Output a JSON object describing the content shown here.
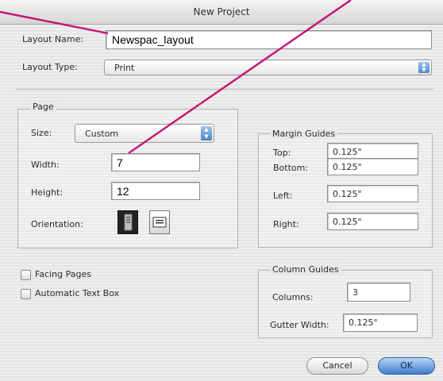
{
  "window": {
    "title": "New Project"
  },
  "layout": {
    "name_label": "Layout Name:",
    "name_value": "Newspac_layout",
    "type_label": "Layout Type:",
    "type_value": "Print"
  },
  "page": {
    "group_label": "Page",
    "size_label": "Size:",
    "size_value": "Custom",
    "width_label": "Width:",
    "width_value": "7",
    "height_label": "Height:",
    "height_value": "12",
    "orientation_label": "Orientation:",
    "orientation_selected": "portrait"
  },
  "margins": {
    "group_label": "Margin Guides",
    "top_label": "Top:",
    "top_value": "0.125\"",
    "bottom_label": "Bottom:",
    "bottom_value": "0.125\"",
    "left_label": "Left:",
    "left_value": "0.125\"",
    "right_label": "Right:",
    "right_value": "0.125\""
  },
  "options": {
    "facing_pages_label": "Facing Pages",
    "facing_pages_checked": false,
    "auto_text_box_label": "Automatic Text Box",
    "auto_text_box_checked": false
  },
  "columns": {
    "group_label": "Column Guides",
    "columns_label": "Columns:",
    "columns_value": "3",
    "gutter_label": "Gutter Width:",
    "gutter_value": "0.125\""
  },
  "buttons": {
    "cancel": "Cancel",
    "ok": "OK"
  },
  "colors": {
    "annotation_line": "#c3177a",
    "default_button": "#3d7ccb"
  }
}
